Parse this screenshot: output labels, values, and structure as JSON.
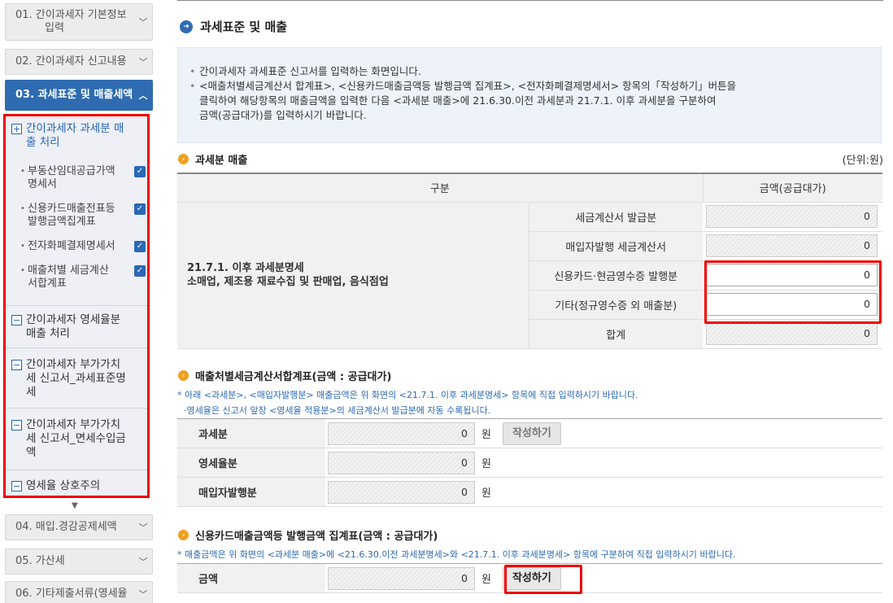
{
  "sidebar": {
    "steps": [
      {
        "label": "01. 간이과세자 기본정보입력",
        "line1": "01. 간이과세자 기본정보",
        "line2": "입력"
      },
      {
        "label": "02. 간이과세자 신고내용"
      },
      {
        "label": "03. 과세표준 및 매출세액"
      },
      {
        "label": "04. 매입.경감공제세액"
      },
      {
        "label": "05. 가산세"
      },
      {
        "label": "06. 기타제출서류(영세율"
      }
    ],
    "sub_sections": [
      {
        "line1": "간이과세자 과세분 매",
        "line2": "출 처리",
        "toggle": "+"
      },
      {
        "line1": "간이과세자 영세율분",
        "line2": "매출 처리",
        "toggle": "−"
      },
      {
        "line1": "간이과세자 부가가치",
        "line2": "세 신고서_과세표준명",
        "line3": "세",
        "toggle": "−"
      },
      {
        "line1": "간이과세자 부가가치",
        "line2": "세 신고서_면세수입금",
        "line3": "액",
        "toggle": "−"
      },
      {
        "line1": "영세율 상호주의",
        "toggle": "−"
      }
    ],
    "sub_items": [
      {
        "line1": "부동산임대공급가액",
        "line2": "명세서"
      },
      {
        "line1": "신용카드매출전표등",
        "line2": "발행금액집계표"
      },
      {
        "line1": "전자화폐결제명세서",
        "line2": ""
      },
      {
        "line1": "매출처별 세금계산",
        "line2": "서합계표"
      }
    ],
    "bullet": "•",
    "check": "✓"
  },
  "main": {
    "title": "과세표준 및 매출",
    "info": {
      "line1": "간이과세자 과세표준 신고서를 입력하는 화면입니다.",
      "line2": "<매출처별세금계산서 합계표>, <신용카드매출금액등 발행금액 집계표>, <전자화폐결제명세서> 항목의「작성하기」버튼을",
      "line3": "클릭하여 해당항목의 매출금액을 입력한 다음 <과세분 매출>에 21.6.30.이전 과세분과 21.7.1. 이후 과세분을 구분하여",
      "line4": "금액(공급대가)를 입력하시기 바랍니다.",
      "bullet": "•"
    },
    "section1": {
      "title": "과세분 매출",
      "unit": "(단위:원)",
      "col_category": "구분",
      "col_amount": "금액(공급대가)",
      "row_head1": "21.7.1. 이후 과세분명세",
      "row_head2": "소매업, 제조용 재료수집 및 판매업, 음식점업",
      "rows": [
        {
          "label": "세금계산서 발급분",
          "value": "0"
        },
        {
          "label": "매입자발행 세금계산서",
          "value": "0"
        },
        {
          "label": "신용카드·현금영수증 발행분",
          "value": "0"
        },
        {
          "label": "기타(정규영수증 외 매출분)",
          "value": "0"
        },
        {
          "label": "합계",
          "value": "0"
        }
      ]
    },
    "section2": {
      "title": "매출처별세금계산서합계표(금액 : 공급대가)",
      "note1": "* 아래 <과세분>, <매입자발행분> 매출금액은 위 화면의 <21.7.1. 이후 과세분명세> 항목에 직접 입력하시기 바랍니다.",
      "note2": "·영세율은 신고서 앞장 <영세율 적용분>의 세금계산서 발급분에 자동 수록됩니다.",
      "rows": [
        {
          "label": "과세분",
          "value": "0",
          "unit": "원",
          "button": "작성하기"
        },
        {
          "label": "영세율분",
          "value": "0",
          "unit": "원"
        },
        {
          "label": "매입자발행분",
          "value": "0",
          "unit": "원"
        }
      ]
    },
    "section3": {
      "title": "신용카드매출금액등 발행금액 집계표(금액 : 공급대가)",
      "note": "* 매출금액은 위 화면의 <과세분 매출>에 <21.6.30.이전 과세분명세>와 <21.7.1. 이후 과세분명세> 항목에 구분하여 직접 입력하시기 바랍니다.",
      "rows": [
        {
          "label": "금액",
          "value": "0",
          "unit": "원",
          "button": "작성하기"
        }
      ]
    },
    "icons": {
      "title_icon": "➜",
      "section_icon": "›",
      "chevron_down": "⌄",
      "chevron_up": "^",
      "scroll_down": "▼"
    }
  }
}
